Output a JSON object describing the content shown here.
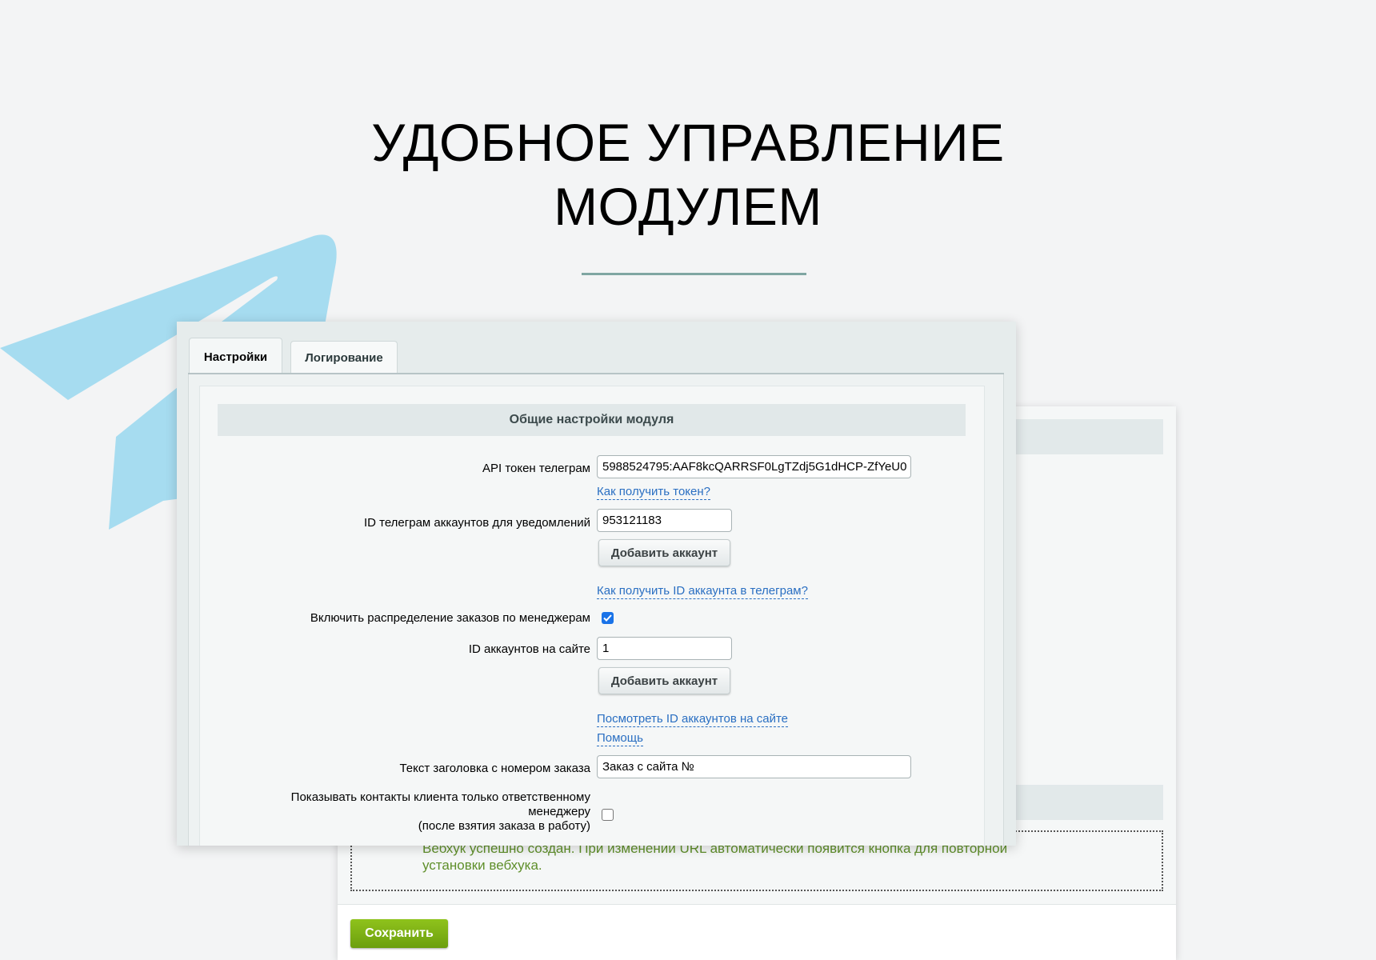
{
  "headline": {
    "line1": "УДОБНОЕ УПРАВЛЕНИЕ",
    "line2": "МОДУЛЕМ"
  },
  "tabs": [
    {
      "label": "Настройки",
      "active": true
    },
    {
      "label": "Логирование",
      "active": false
    }
  ],
  "section": {
    "title": "Общие настройки модуля"
  },
  "form": {
    "api_token": {
      "label": "API токен телеграм",
      "value": "5988524795:AAF8kcQARRSF0LgTZdj5G1dHCP-ZfYeU0",
      "help_link": "Как получить токен?"
    },
    "tg_ids": {
      "label": "ID телеграм аккаунтов для уведомлений",
      "value": "953121183",
      "add_button": "Добавить аккаунт",
      "help_link": "Как получить ID аккаунта в телеграм?"
    },
    "distribute": {
      "label": "Включить распределение заказов по менеджерам",
      "checked": true
    },
    "site_ids": {
      "label": "ID аккаунтов на сайте",
      "value": "1",
      "add_button": "Добавить аккаунт",
      "view_link": "Посмотреть ID аккаунтов на сайте",
      "help_link": "Помощь"
    },
    "header_text": {
      "label": "Текст заголовка с номером заказа",
      "value": "Заказ с сайта №"
    },
    "contacts_only": {
      "label_line1": "Показывать контакты клиента только ответственному",
      "label_line2": "менеджеру",
      "label_line3": "(после взятия заказа в работу)",
      "checked": false
    }
  },
  "back_panel": {
    "webhook_message_line1": "Вебхук успешно создан. При изменении URL автоматически появится кнопка для повторной",
    "webhook_message_line2": "установки вебхука.",
    "save_button": "Сохранить"
  },
  "colors": {
    "accent_link": "#2a6fc2",
    "checkbox_on": "#1a73e8",
    "save_green": "#7ab317",
    "success_text": "#5f8f2a",
    "plane_blue": "#a6dcf0"
  }
}
